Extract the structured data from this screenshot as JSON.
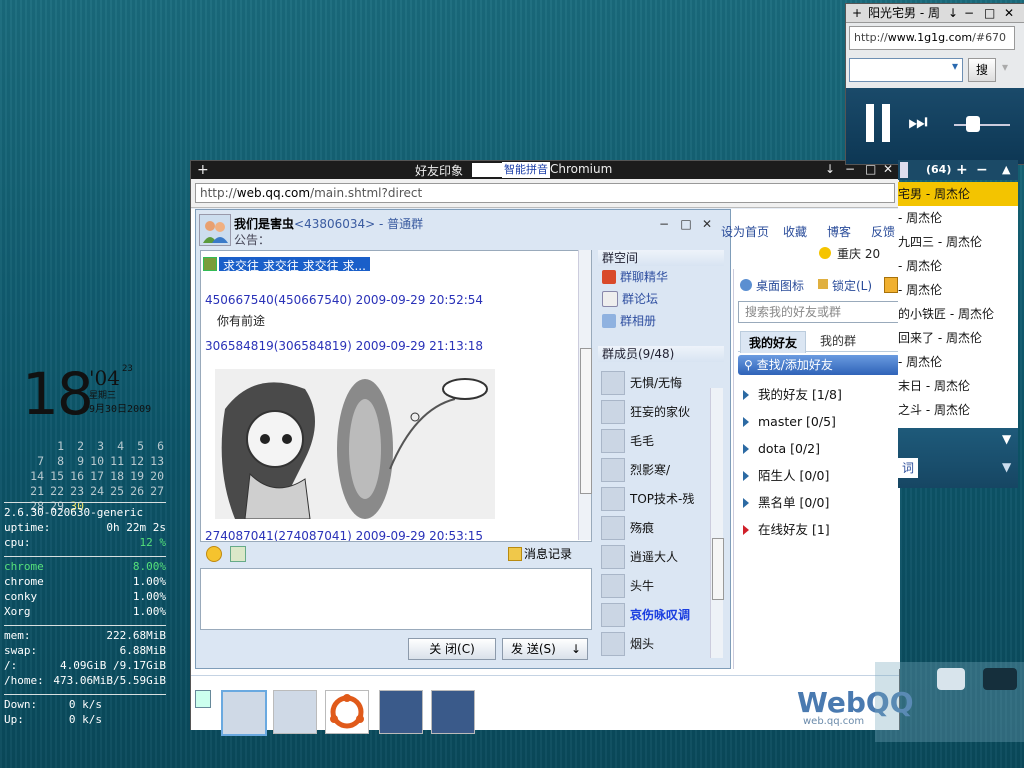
{
  "conky": {
    "day": "18",
    "minute": "'04",
    "second": "23",
    "weekday": "星期三",
    "date": "9月30日2009",
    "calendar": [
      [
        "",
        "",
        "",
        "",
        "",
        "",
        ""
      ],
      [
        "",
        "1",
        "2",
        "3",
        "4",
        "5",
        "6"
      ],
      [
        "7",
        "8",
        "9",
        "10",
        "11",
        "12",
        "13"
      ],
      [
        "14",
        "15",
        "16",
        "17",
        "18",
        "19",
        "20"
      ],
      [
        "21",
        "22",
        "23",
        "24",
        "25",
        "26",
        "27"
      ],
      [
        "28",
        "29",
        "30",
        "",
        "",
        "",
        ""
      ]
    ],
    "today": "30",
    "kernel": "2.6.30-020630-generic",
    "uptime_label": "uptime:",
    "uptime": "0h 22m 2s",
    "cpu_label": "cpu:",
    "cpu": "12 %",
    "processes": [
      {
        "name": "chrome",
        "value": "8.00%",
        "highlight": true
      },
      {
        "name": "chrome",
        "value": "1.00%"
      },
      {
        "name": "conky",
        "value": "1.00%"
      },
      {
        "name": "Xorg",
        "value": "1.00%"
      }
    ],
    "mem_label": "mem:",
    "mem": "222.68MiB",
    "swap_label": "swap:",
    "swap": "6.88MiB",
    "root_label": "/:",
    "root": "4.09GiB /9.17GiB",
    "home_label": "/home:",
    "home": "473.06MiB/5.59GiB",
    "down_label": "Down:",
    "down": "0    k/s",
    "up_label": "Up:",
    "up": "0    k/s"
  },
  "chromium": {
    "tab_title": "好友印象",
    "ime_label": "智能拼音",
    "app_name": "Chromium",
    "url_prefix": "http://",
    "url_host": "web.qq.com",
    "url_path": "/main.shtml?direct"
  },
  "chat": {
    "group_name": "我们是害虫",
    "group_num": "<43806034>",
    "group_type": " - 普通群",
    "notice": "公告：",
    "selected_text": "求交往 求交往 求交往 求...",
    "messages": [
      {
        "head": "450667540(450667540)  2009-09-29 20:52:54",
        "body": "你有前途"
      },
      {
        "head": "306584819(306584819)  2009-09-29 21:13:18",
        "body": ""
      },
      {
        "head": "274087041(274087041)  2009-09-29 20:53:15",
        "body": ""
      }
    ],
    "history_label": "消息记录",
    "close_label": "关 闭(C)",
    "send_label": "发 送(S)",
    "group_space_title": "群空间",
    "space_items": [
      "群聊精华",
      "群论坛",
      "群相册"
    ],
    "members_title": "群成员(9/48)",
    "members": [
      "无惧/无悔",
      "狂妄的家伙",
      "毛毛",
      "烈影寒/",
      "TOP技术-残",
      "殇痕",
      "逍遥大人",
      "头牛",
      "哀伤咏叹调",
      "烟头"
    ],
    "vip_member": "哀伤咏叹调"
  },
  "qq": {
    "links": [
      "设为首页",
      "收藏",
      "博客",
      "反馈"
    ],
    "weather": "重庆 20",
    "desktop_icon": "桌面图标",
    "lock": "锁定(L)",
    "search_placeholder": "搜索我的好友或群",
    "tab_friends": "我的好友",
    "tab_groups": "我的群",
    "find_add": "查找/添加好友",
    "groups": [
      {
        "label": "我的好友 [1/8]"
      },
      {
        "label": "master [0/5]"
      },
      {
        "label": "dota [0/2]"
      },
      {
        "label": "陌生人 [0/0]"
      },
      {
        "label": "黑名单 [0/0]"
      },
      {
        "label": "在线好友 [1]",
        "red": true
      }
    ],
    "logo": "WebQQ",
    "logo_sub": "web.qq.com"
  },
  "music": {
    "title": "阳光宅男 - 周",
    "url_prefix": "http://",
    "url_host": "www.1g1g.com",
    "url_rest": "/#670",
    "search_btn": "搜",
    "count": "(64)",
    "playlist": [
      "宅男 - 周杰伦",
      "- 周杰伦",
      "九四三 - 周杰伦",
      "- 周杰伦",
      "- 周杰伦",
      "的小铁匠 - 周杰伦",
      "回来了 - 周杰伦",
      "- 周杰伦",
      "末日 - 周杰伦",
      "之斗 - 周杰伦"
    ],
    "footer_label": "词"
  }
}
